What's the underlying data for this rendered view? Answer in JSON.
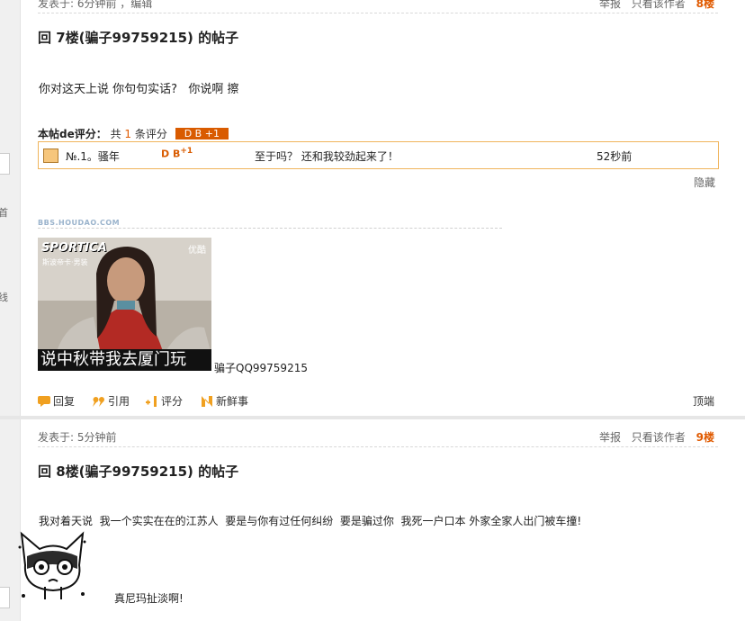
{
  "post7": {
    "meta_left": "发表于: 6分钟前  ，编辑",
    "report": "举报",
    "only_author": "只看该作者",
    "floor": "8楼",
    "title": "回 7楼(骗子99759215) 的帖子",
    "body": "你对这天上说 你句句实话?   你说啊 擦",
    "rating": {
      "label": "本帖de评分：",
      "count_prefix": "共",
      "count": "1",
      "count_suffix": "条评分",
      "badge": "D B  +1",
      "rows": [
        {
          "rank": "№.1。骚年",
          "score": "D B",
          "score_plus": "+1",
          "reason": "至于吗？ 还和我较劲起来了！",
          "time": "52秒前"
        }
      ],
      "hide": "隐藏"
    },
    "signature_site": "BBS.HOUDAO.COM",
    "gif": {
      "brand": "SPORTICA",
      "brand_sub": "斯波帝卡·男装",
      "tag": "优酷",
      "caption": "说中秋带我去厦门玩"
    },
    "after_gif": "骗子QQ99759215",
    "actions": {
      "reply": "回复",
      "quote": "引用",
      "rate": "评分",
      "fresh": "新鲜事",
      "top": "顶端"
    }
  },
  "post8": {
    "meta_left": "发表于: 5分钟前",
    "report": "举报",
    "only_author": "只看该作者",
    "floor": "9楼",
    "title": "回 8楼(骗子99759215) 的帖子",
    "body": "我对着天说  我一个实实在在的江苏人  要是与你有过任何纠纷  要是骗过你  我死一户口本 外家全家人出门被车撞!",
    "after_emoji": "真尼玛扯淡啊!"
  },
  "sidebar_chars": [
    "首",
    "线"
  ],
  "colors": {
    "accent": "#d95b00",
    "rating_border": "#f0b45c"
  }
}
